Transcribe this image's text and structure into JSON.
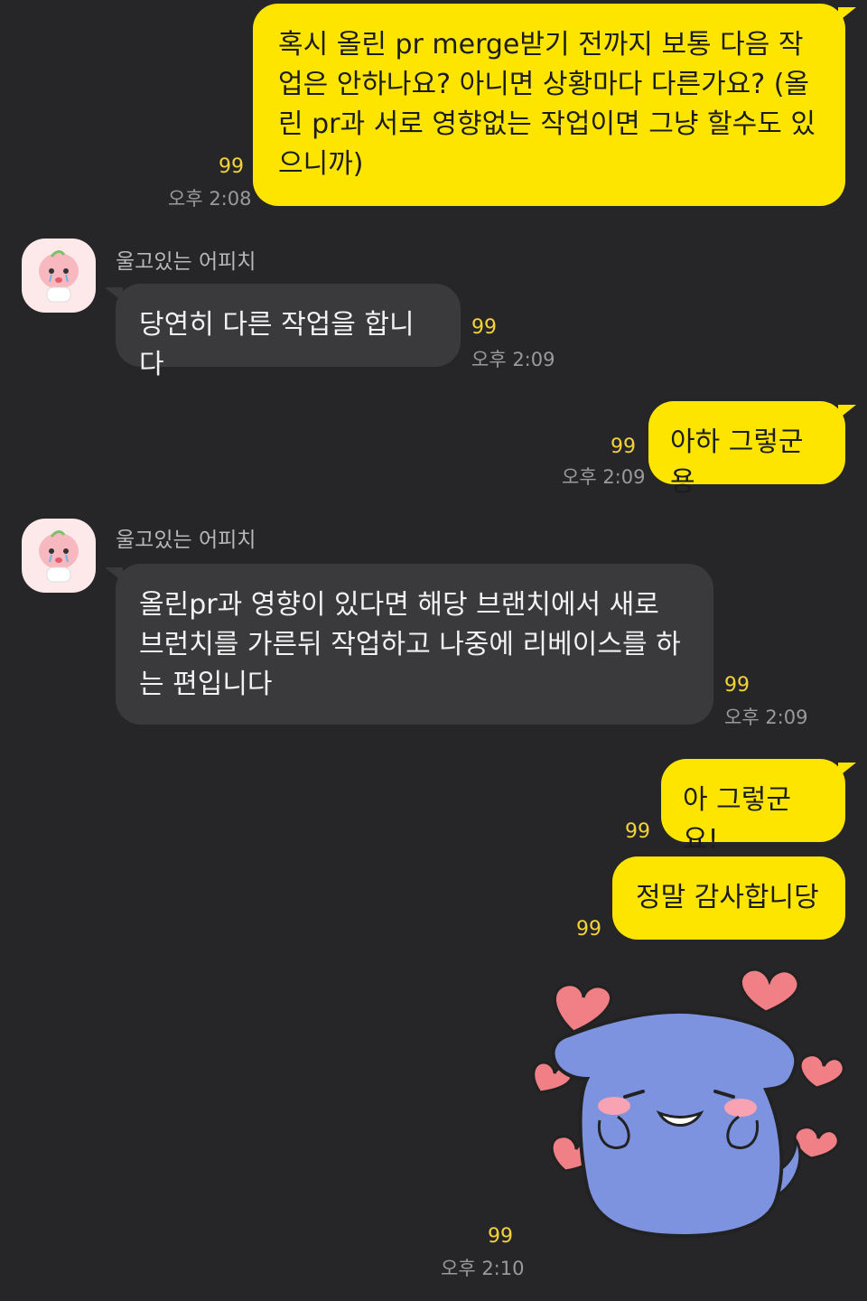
{
  "contact": {
    "name": "울고있는 어피치"
  },
  "messages": {
    "m1": {
      "text": "혹시 올린 pr merge받기 전까지 보통 다음 작업은 안하나요? 아니면 상황마다 다른가요? (올린 pr과 서로 영향없는 작업이면 그냥 할수도 있으니까)",
      "unread": "99",
      "time": "오후 2:08"
    },
    "m2": {
      "text": "당연히 다른 작업을 합니다",
      "unread": "99",
      "time": "오후 2:09"
    },
    "m3": {
      "text": "아하 그렇군용",
      "unread": "99",
      "time": "오후 2:09"
    },
    "m4": {
      "text": "올린pr과 영향이 있다면 해당 브랜치에서 새로 브런치를 가른뒤 작업하고 나중에 리베이스를 하는 편입니다",
      "unread": "99",
      "time": "오후 2:09"
    },
    "m5": {
      "text": "아 그렇군요!",
      "unread": "99"
    },
    "m6": {
      "text": "정말 감사합니당",
      "unread": "99"
    },
    "m7": {
      "sticker": "blue-puppy-hearts-sticker",
      "unread": "99",
      "time": "오후 2:10"
    }
  },
  "colors": {
    "my_bubble": "#FEE500",
    "other_bubble": "#3a3a3c",
    "background": "#262628",
    "unread": "#f3d33a",
    "sticker_body": "#7d93e0",
    "heart": "#f07f86"
  }
}
